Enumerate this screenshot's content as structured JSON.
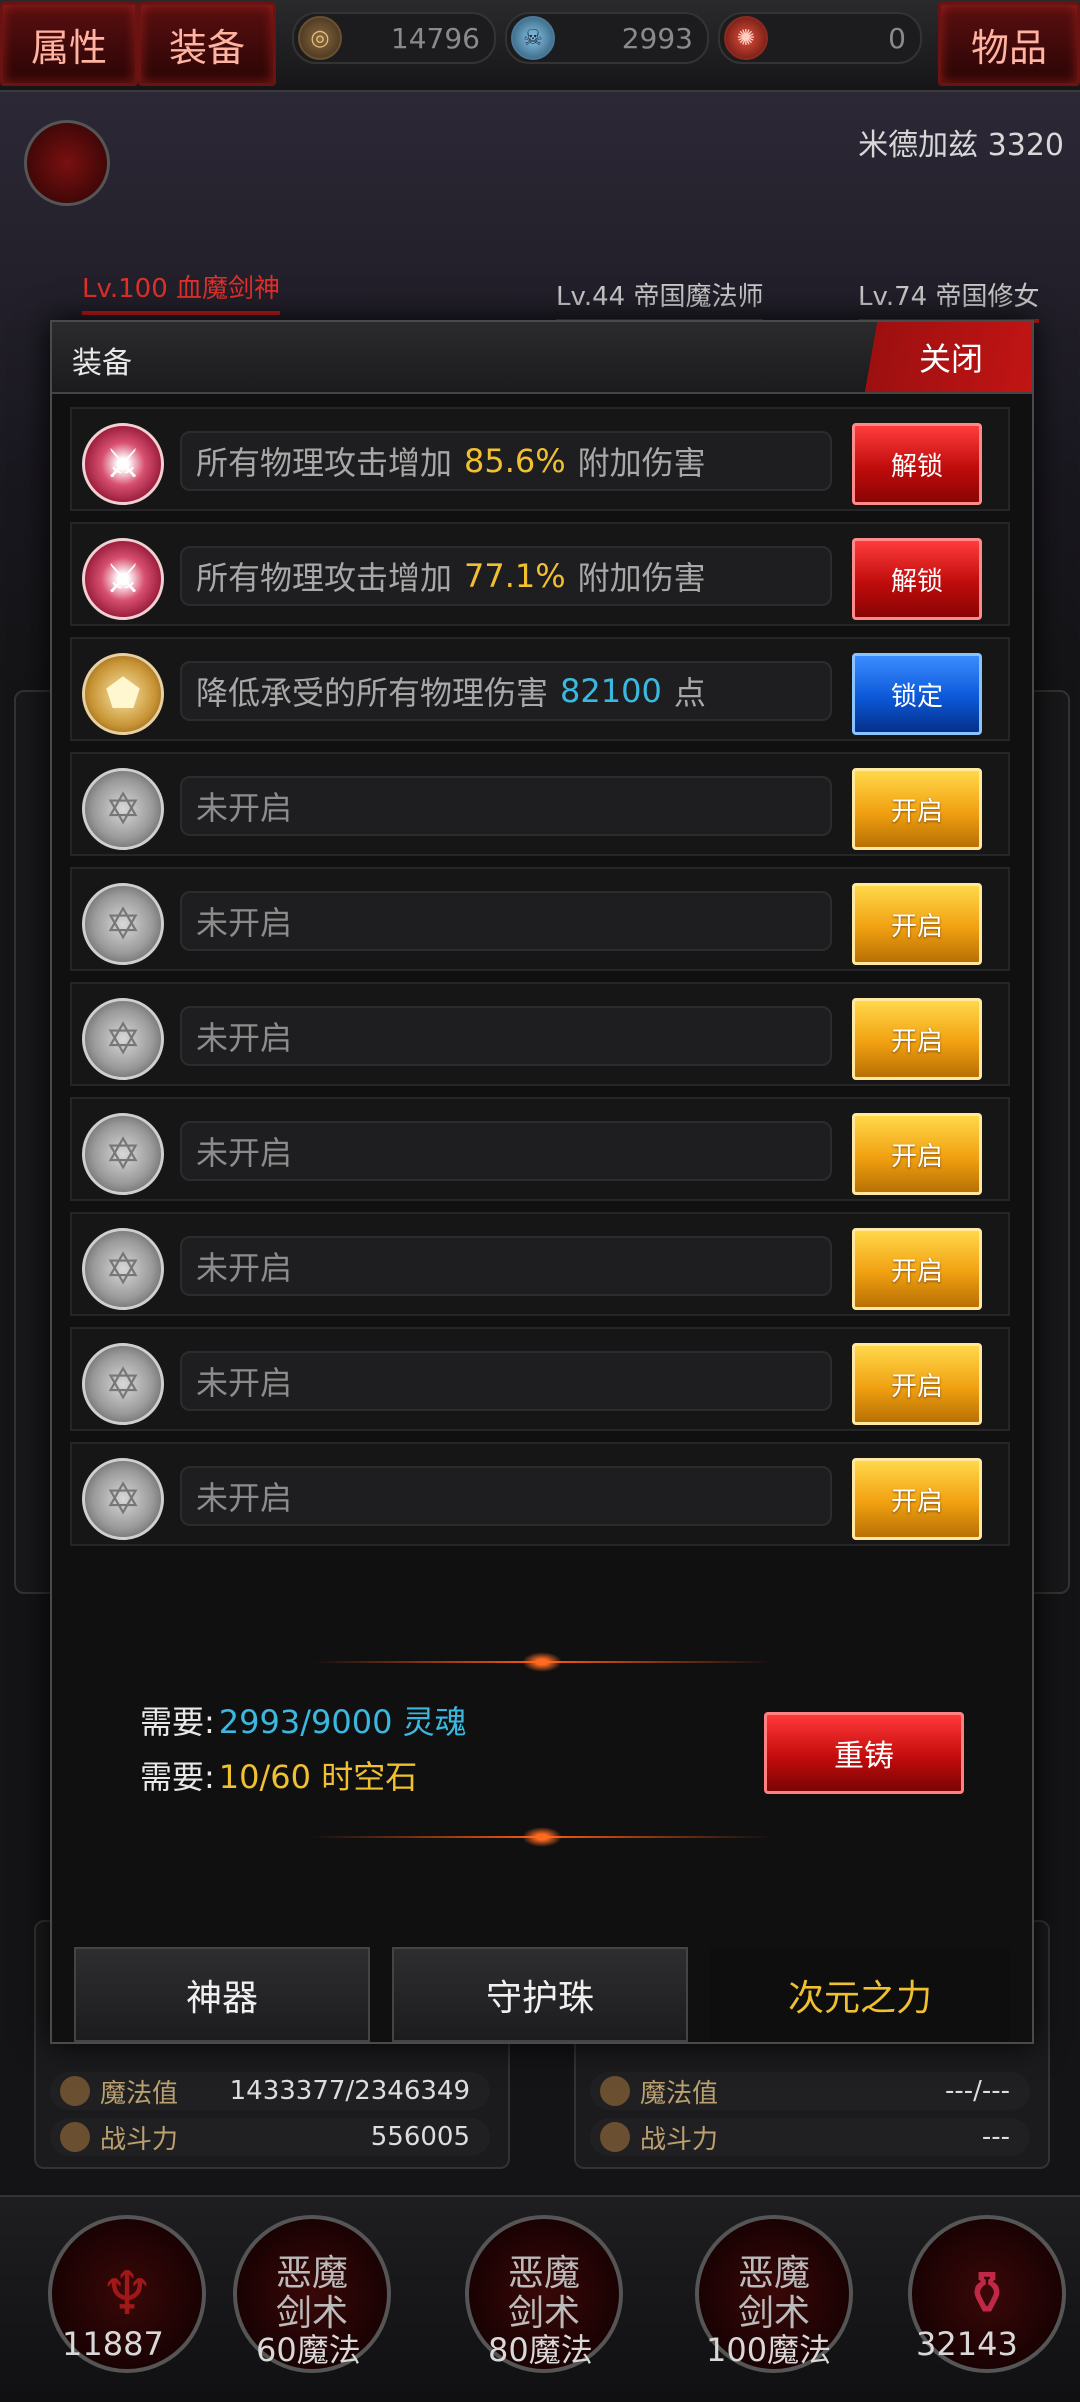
{
  "topbar": {
    "tab_attributes": "属性",
    "tab_equipment": "装备",
    "tab_items": "物品",
    "resources": [
      {
        "icon": "gold-coin-icon",
        "value": "14796",
        "color": "#b8a070"
      },
      {
        "icon": "soul-skull-icon",
        "value": "2993",
        "color": "#7ab0d8"
      },
      {
        "icon": "spacetime-stone-icon",
        "value": "0",
        "color": "#d04030"
      }
    ]
  },
  "scene": {
    "enemy_label": "米德加兹 3320",
    "heroes": [
      {
        "level": "Lv.100",
        "name": "血魔剑神",
        "color": "#e0302a"
      },
      {
        "level": "Lv.44",
        "name": "帝国魔法师",
        "color": "#c8c8c8"
      },
      {
        "level": "Lv.74",
        "name": "帝国修女",
        "color": "#c8c8c8"
      }
    ],
    "stats_left": [
      {
        "label": "魔法值",
        "value": "1433377/2346349"
      },
      {
        "label": "战斗力",
        "value": "556005"
      }
    ],
    "stats_right": [
      {
        "label": "魔法值",
        "value": "---/---"
      },
      {
        "label": "战斗力",
        "value": "---"
      }
    ]
  },
  "modal": {
    "title": "装备",
    "close_label": "关闭",
    "rows": [
      {
        "emblem": "sword-cross-emblem-icon",
        "kind": "red",
        "text_before": "所有物理攻击增加",
        "value": "85.6%",
        "text_after": "附加伤害",
        "value_color": "gold",
        "button": "解锁",
        "button_kind": "red"
      },
      {
        "emblem": "sword-cross-emblem-icon",
        "kind": "red",
        "text_before": "所有物理攻击增加",
        "value": "77.1%",
        "text_after": "附加伤害",
        "value_color": "gold",
        "button": "解锁",
        "button_kind": "red"
      },
      {
        "emblem": "gold-shield-emblem-icon",
        "kind": "gold",
        "text_before": "降低承受的所有物理伤害",
        "value": "82100",
        "text_after": "点",
        "value_color": "cyan",
        "button": "锁定",
        "button_kind": "blue"
      },
      {
        "emblem": "locked-hexagram-emblem-icon",
        "kind": "grey",
        "text_before": "未开启",
        "value": "",
        "text_after": "",
        "value_color": "",
        "button": "开启",
        "button_kind": "gold"
      },
      {
        "emblem": "locked-hexagram-emblem-icon",
        "kind": "grey",
        "text_before": "未开启",
        "value": "",
        "text_after": "",
        "value_color": "",
        "button": "开启",
        "button_kind": "gold"
      },
      {
        "emblem": "locked-hexagram-emblem-icon",
        "kind": "grey",
        "text_before": "未开启",
        "value": "",
        "text_after": "",
        "value_color": "",
        "button": "开启",
        "button_kind": "gold"
      },
      {
        "emblem": "locked-hexagram-emblem-icon",
        "kind": "grey",
        "text_before": "未开启",
        "value": "",
        "text_after": "",
        "value_color": "",
        "button": "开启",
        "button_kind": "gold"
      },
      {
        "emblem": "locked-hexagram-emblem-icon",
        "kind": "grey",
        "text_before": "未开启",
        "value": "",
        "text_after": "",
        "value_color": "",
        "button": "开启",
        "button_kind": "gold"
      },
      {
        "emblem": "locked-hexagram-emblem-icon",
        "kind": "grey",
        "text_before": "未开启",
        "value": "",
        "text_after": "",
        "value_color": "",
        "button": "开启",
        "button_kind": "gold"
      },
      {
        "emblem": "locked-hexagram-emblem-icon",
        "kind": "grey",
        "text_before": "未开启",
        "value": "",
        "text_after": "",
        "value_color": "",
        "button": "开启",
        "button_kind": "gold"
      }
    ],
    "requirements": [
      {
        "label": "需要:",
        "value": "2993/9000 灵魂",
        "color": "cyan"
      },
      {
        "label": "需要:",
        "value": "10/60 时空石",
        "color": "gold"
      }
    ],
    "recast_label": "重铸",
    "tabs": [
      "神器",
      "守护珠",
      "次元之力"
    ],
    "active_tab": 2
  },
  "skills": [
    {
      "label": "",
      "number": "11887"
    },
    {
      "label": "恶魔\n剑术",
      "number": "60魔法"
    },
    {
      "label": "恶魔\n剑术",
      "number": "80魔法"
    },
    {
      "label": "恶魔\n剑术",
      "number": "100魔法"
    },
    {
      "label": "",
      "number": "32143"
    }
  ]
}
